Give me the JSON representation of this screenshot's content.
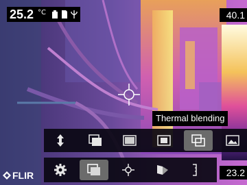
{
  "readout": {
    "temperature": "25.2",
    "unit": "°C"
  },
  "scale": {
    "max_label": "40.1",
    "min_label": "23.2"
  },
  "tooltip": {
    "label": "Thermal blending"
  },
  "submenu": {
    "items": [
      {
        "icon": "measurement-arrow-icon"
      },
      {
        "icon": "picture-in-picture-icon"
      },
      {
        "icon": "thermal-mode-icon"
      },
      {
        "icon": "thermal-msx-icon"
      },
      {
        "icon": "thermal-blending-icon",
        "selected": true
      },
      {
        "icon": "digital-camera-icon"
      }
    ]
  },
  "mainmenu": {
    "items": [
      {
        "icon": "settings-gear-icon"
      },
      {
        "icon": "image-mode-icon",
        "selected": true
      },
      {
        "icon": "measurement-spot-icon"
      },
      {
        "icon": "color-palette-icon"
      },
      {
        "icon": "temperature-scale-icon"
      }
    ]
  },
  "brand": {
    "logo": "FLIR"
  },
  "colors": {
    "thermal_hot": "#f5e26a",
    "thermal_mid": "#c060c8",
    "thermal_cool": "#3a2a7a",
    "menu_bg": "#0a0812",
    "selected": "#6b6b6b"
  }
}
